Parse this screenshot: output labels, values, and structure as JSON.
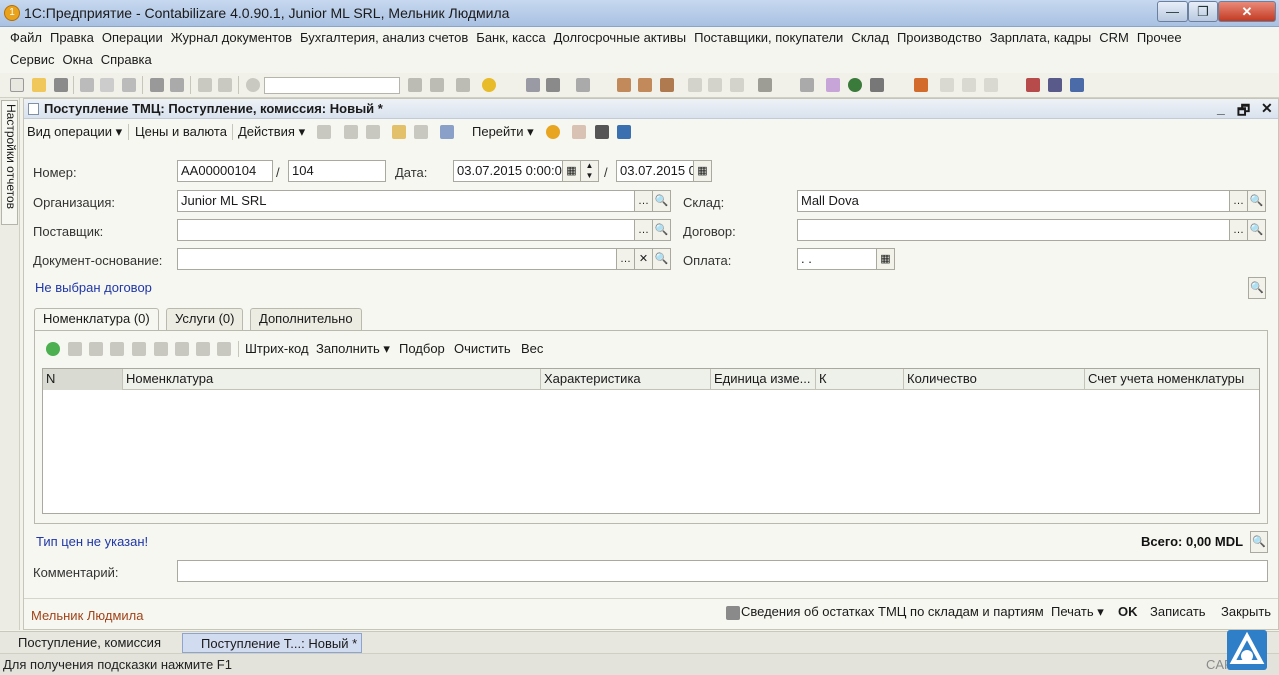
{
  "window": {
    "title": "1С:Предприятие - Contabilizare 4.0.90.1, Junior ML SRL, Мельник Людмила",
    "min": "—",
    "max": "❐",
    "close": "✕"
  },
  "menu": {
    "row1": [
      "Файл",
      "Правка",
      "Операции",
      "Журнал документов",
      "Бухгалтерия, анализ счетов",
      "Банк, касса",
      "Долгосрочные активы",
      "Поставщики, покупатели",
      "Склад",
      "Производство",
      "Зарплата, кадры",
      "CRM",
      "Прочее"
    ],
    "row2": [
      "Сервис",
      "Окна",
      "Справка"
    ]
  },
  "side_panel": {
    "label": "Настройки отчетов"
  },
  "document": {
    "title": "Поступление ТМЦ: Поступление, комиссия: Новый *",
    "controls": [
      "_",
      "🗗",
      "✕"
    ],
    "commands": {
      "operation_type": "Вид операции ▾",
      "prices": "Цены и валюта",
      "actions": "Действия ▾",
      "goto": "Перейти ▾"
    },
    "fields": {
      "number_label": "Номер:",
      "number_value": "АА00000104",
      "number_sep": "/",
      "number_suffix": "104",
      "date_label": "Дата:",
      "date_value": "03.07.2015 0:00:00",
      "date_sep": "/",
      "date2_value": "03.07.2015 0:",
      "org_label": "Организация:",
      "org_value": "Junior ML SRL",
      "warehouse_label": "Склад:",
      "warehouse_value": "Mall Dova",
      "supplier_label": "Поставщик:",
      "supplier_value": "",
      "contract_label": "Договор:",
      "contract_value": "",
      "basis_label": "Документ-основание:",
      "basis_value": "",
      "payment_label": "Оплата:",
      "payment_value": " .  ."
    },
    "no_contract_link": "Не выбран договор",
    "tabs": [
      "Номенклатура (0)",
      "Услуги (0)",
      "Дополнительно"
    ],
    "table_commands": [
      "Штрих-код",
      "Заполнить ▾",
      "Подбор",
      "Очистить",
      "Вес"
    ],
    "columns": [
      "N",
      "Номенклатура",
      "Характеристика",
      "Единица изме...",
      "К",
      "Количество",
      "Счет учета номенклатуры"
    ],
    "price_type_link": "Тип цен не указан!",
    "total": "Всего: 0,00 MDL",
    "comment_label": "Комментарий:",
    "comment_value": "",
    "author": "Мельник Людмила",
    "footer_actions": {
      "stock_info": "Сведения об остатках ТМЦ по складам и партиям",
      "print": "Печать ▾",
      "ok": "OK",
      "save": "Записать",
      "close": "Закрыть"
    }
  },
  "window_tabs": [
    "Поступление, комиссия",
    "Поступление Т...: Новый *"
  ],
  "hint": "Для получения подсказки нажмите F1",
  "status_right": "CAP  NUM"
}
